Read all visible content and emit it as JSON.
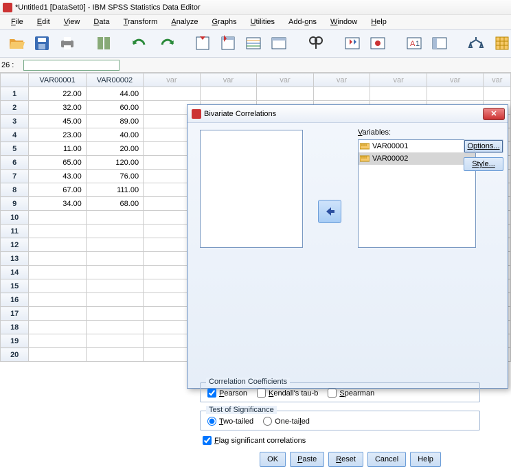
{
  "window": {
    "title": "*Untitled1 [DataSet0] - IBM SPSS Statistics Data Editor"
  },
  "menu": [
    "File",
    "Edit",
    "View",
    "Data",
    "Transform",
    "Analyze",
    "Graphs",
    "Utilities",
    "Add-ons",
    "Window",
    "Help"
  ],
  "cellref": "26 :",
  "columns": {
    "c1": "VAR00001",
    "c2": "VAR00002",
    "var": "var"
  },
  "rows": [
    {
      "n": "1",
      "a": "22.00",
      "b": "44.00"
    },
    {
      "n": "2",
      "a": "32.00",
      "b": "60.00"
    },
    {
      "n": "3",
      "a": "45.00",
      "b": "89.00"
    },
    {
      "n": "4",
      "a": "23.00",
      "b": "40.00"
    },
    {
      "n": "5",
      "a": "11.00",
      "b": "20.00"
    },
    {
      "n": "6",
      "a": "65.00",
      "b": "120.00"
    },
    {
      "n": "7",
      "a": "43.00",
      "b": "76.00"
    },
    {
      "n": "8",
      "a": "67.00",
      "b": "111.00"
    },
    {
      "n": "9",
      "a": "34.00",
      "b": "68.00"
    },
    {
      "n": "10",
      "a": "",
      "b": ""
    },
    {
      "n": "11",
      "a": "",
      "b": ""
    },
    {
      "n": "12",
      "a": "",
      "b": ""
    },
    {
      "n": "13",
      "a": "",
      "b": ""
    },
    {
      "n": "14",
      "a": "",
      "b": ""
    },
    {
      "n": "15",
      "a": "",
      "b": ""
    },
    {
      "n": "16",
      "a": "",
      "b": ""
    },
    {
      "n": "17",
      "a": "",
      "b": ""
    },
    {
      "n": "18",
      "a": "",
      "b": ""
    },
    {
      "n": "19",
      "a": "",
      "b": ""
    },
    {
      "n": "20",
      "a": "",
      "b": ""
    }
  ],
  "dialog": {
    "title": "Bivariate Correlations",
    "varlabel": "Variables:",
    "vars": [
      "VAR00001",
      "VAR00002"
    ],
    "options": "Options...",
    "style": "Style...",
    "cc": {
      "title": "Correlation Coefficients",
      "pearson": "Pearson",
      "kendall": "Kendall's tau-b",
      "spearman": "Spearman"
    },
    "sig": {
      "title": "Test of Significance",
      "two": "Two-tailed",
      "one": "One-tailed"
    },
    "flag": "Flag significant correlations",
    "btns": {
      "ok": "OK",
      "paste": "Paste",
      "reset": "Reset",
      "cancel": "Cancel",
      "help": "Help"
    }
  }
}
